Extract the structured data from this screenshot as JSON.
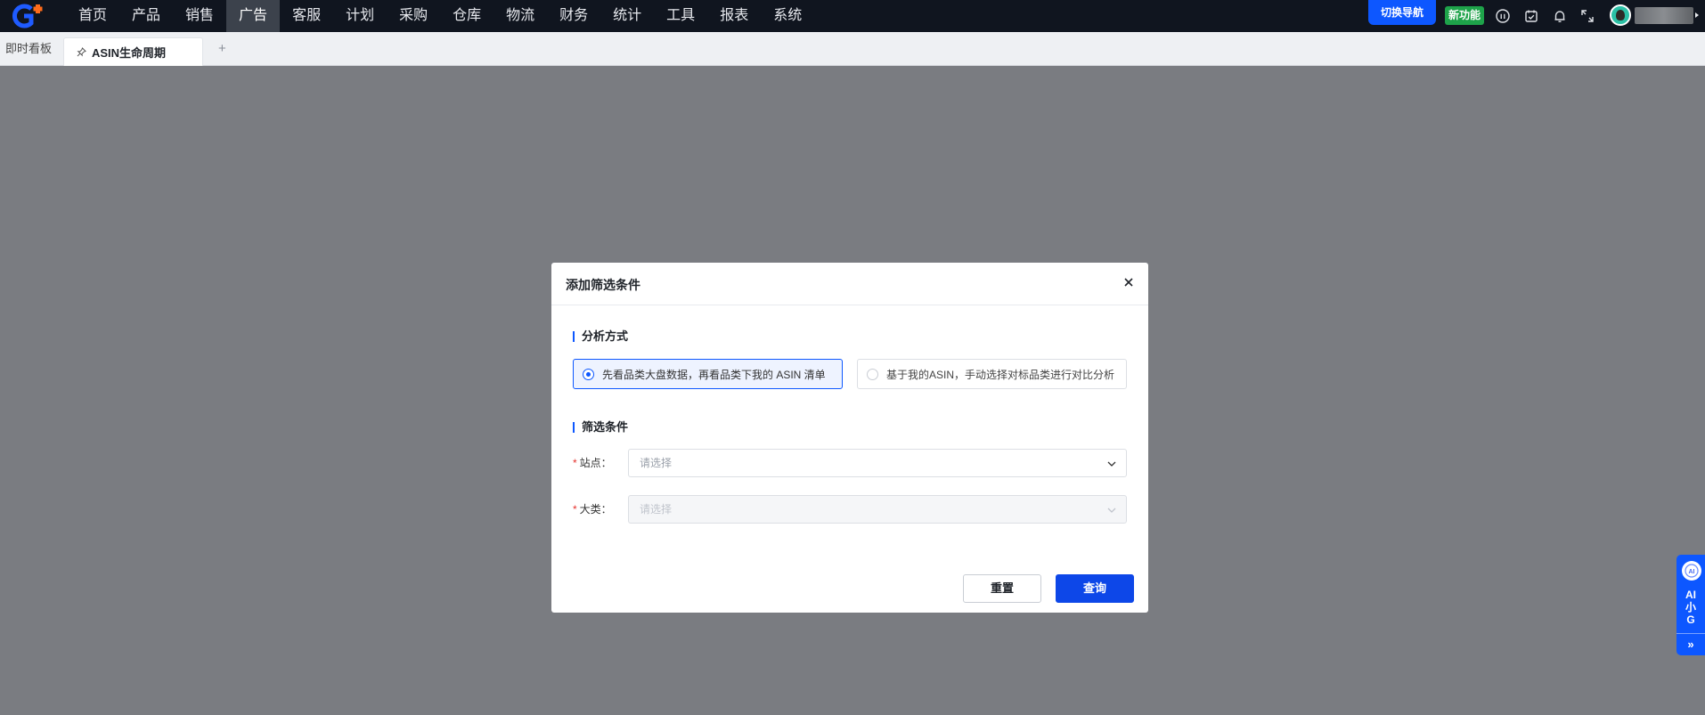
{
  "nav": {
    "items": [
      "首页",
      "产品",
      "销售",
      "广告",
      "客服",
      "计划",
      "采购",
      "仓库",
      "物流",
      "财务",
      "统计",
      "工具",
      "报表",
      "系统"
    ],
    "active_index": 3,
    "switch_nav": "切换导航",
    "new_feature": "新功能",
    "icons": [
      "help-icon",
      "calendar-check-icon",
      "bell-icon",
      "fullscreen-icon"
    ],
    "user_name": ""
  },
  "tabs": {
    "dashboard": "即时看板",
    "active": "ASIN生命周期",
    "add": "+"
  },
  "modal": {
    "title": "添加筛选条件",
    "section_analysis": "分析方式",
    "options": [
      {
        "label": "先看品类大盘数据，再看品类下我的 ASIN 清单",
        "selected": true
      },
      {
        "label": "基于我的ASIN，手动选择对标品类进行对比分析",
        "selected": false
      }
    ],
    "section_filter": "筛选条件",
    "site": {
      "label": "站点：",
      "placeholder": "请选择",
      "required": true
    },
    "category": {
      "label": "大类：",
      "placeholder": "请选择",
      "required": true,
      "disabled": true
    },
    "reset": "重置",
    "query": "查询"
  },
  "ai_widget": {
    "text": "AI\n小\nG",
    "expand": "»"
  },
  "colors": {
    "brand": "#0d57ff",
    "topbar": "#10151f",
    "overlay": "#7a7c81",
    "success": "#1ea34a"
  }
}
